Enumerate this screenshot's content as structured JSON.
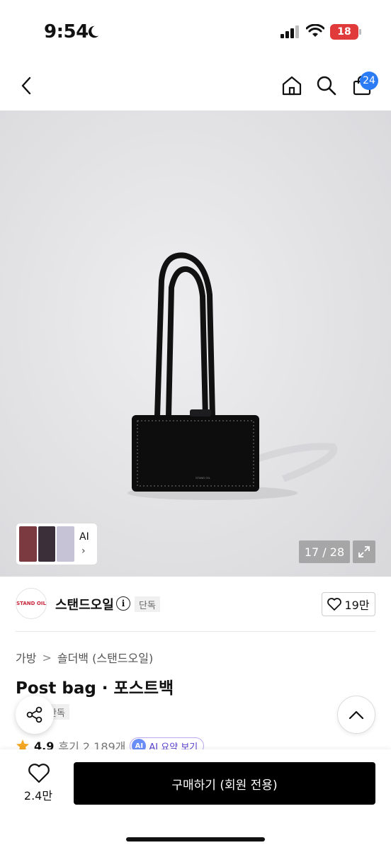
{
  "status": {
    "time": "9:54",
    "battery": "18"
  },
  "header": {
    "cart_count": "24"
  },
  "gallery": {
    "ai_label": "AI",
    "ai_chevron": "›",
    "counter": "17 / 28"
  },
  "brand": {
    "logo_text": "STAND OIL",
    "name": "스탠드오일",
    "info_symbol": "i",
    "exclusive_badge": "단독",
    "like_count": "19만"
  },
  "product": {
    "breadcrumb": [
      "가방",
      "숄더백 (스탠드오일)"
    ],
    "breadcrumb_sep": ">",
    "title": "Post bag · 포스트백",
    "exclusive_badge": "단독",
    "rating": "4.9",
    "reviews": "후기 2,189개",
    "ai_badge": "AI",
    "ai_summary": "AI 요약 보기"
  },
  "bottom": {
    "wish_count": "2.4만",
    "buy_label": "구매하기 (회원 전용)"
  },
  "colors": {
    "accent": "#2b7bf5",
    "battery": "#e03a3a",
    "brand": "#c8273a",
    "star": "#f5a623"
  },
  "icons": [
    "back-icon",
    "home-icon",
    "search-icon",
    "cart-icon",
    "expand-icon",
    "info-icon",
    "heart-icon",
    "share-icon",
    "chevron-up-icon",
    "star-icon",
    "moon-icon",
    "signal-icon",
    "wifi-icon"
  ]
}
